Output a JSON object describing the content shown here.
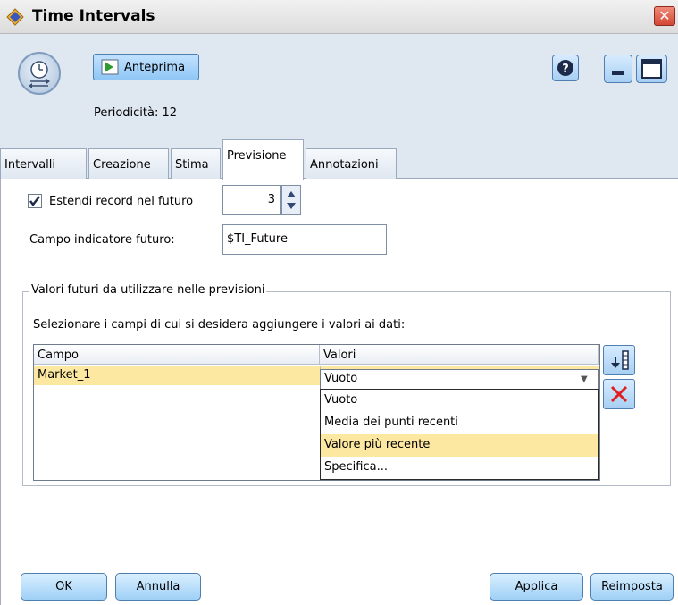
{
  "window": {
    "title": "Time Intervals",
    "close_glyph": "✕"
  },
  "toolbar": {
    "preview_label": "Anteprima",
    "periodicity": "Periodicità: 12"
  },
  "tabs": [
    {
      "label": "Intervalli"
    },
    {
      "label": "Creazione"
    },
    {
      "label": "Stima"
    },
    {
      "label": "Previsione",
      "active": true
    },
    {
      "label": "Annotazioni"
    }
  ],
  "form": {
    "extend_label": "Estendi record nel futuro",
    "extend_checked": true,
    "extend_value": "3",
    "future_field_label": "Campo indicatore futuro:",
    "future_field_value": "$TI_Future"
  },
  "group": {
    "title": "Valori futuri da utilizzare nelle previsioni",
    "instruction": "Selezionare i campi di cui si desidera aggiungere i valori ai dati:",
    "columns": [
      "Campo",
      "Valori"
    ],
    "rows": [
      {
        "campo": "Market_1",
        "valori": "Vuoto"
      }
    ],
    "dropdown_options": [
      "Vuoto",
      "Media dei punti recenti",
      "Valore più recente",
      "Specifica..."
    ],
    "highlighted_option_index": 2
  },
  "buttons": {
    "ok": "OK",
    "cancel": "Annulla",
    "apply": "Applica",
    "reset": "Reimposta"
  },
  "colors": {
    "accent": "#9fd0f6",
    "selection": "#fde8a1",
    "close_red": "#d24733",
    "delete_red": "#e02020"
  },
  "icons": {
    "title": "diamond-node-icon",
    "node": "clock-arrows-icon",
    "preview": "play-table-icon",
    "help": "help-icon",
    "minimize": "minimize-icon",
    "maximize": "maximize-icon",
    "add_field": "field-picker-icon",
    "delete": "delete-x-icon"
  }
}
